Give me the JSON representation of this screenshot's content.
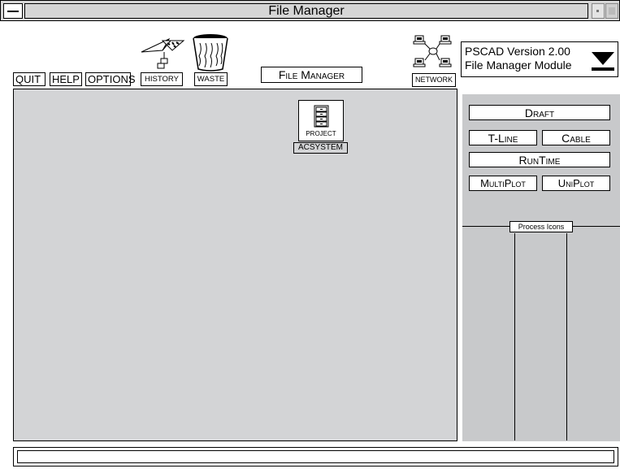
{
  "window": {
    "title": "File Manager"
  },
  "toolbar": {
    "quit_label": "QUIT",
    "help_label": "HELP",
    "options_label": "OPTIONS",
    "history_label": "HISTORY",
    "waste_label": "WASTE",
    "network_label": "NETWORK",
    "module_label": "File Manager"
  },
  "version": {
    "line1": "PSCAD Version 2.00",
    "line2": "File Manager Module"
  },
  "main": {
    "items": [
      {
        "type_label": "PROJECT",
        "name": "ACSYSTEM"
      }
    ]
  },
  "modules": {
    "draft": "Draft",
    "tline": "T-Line",
    "cable": "Cable",
    "runtime": "RunTime",
    "multiplot": "MultiPlot",
    "uniplot": "UniPlot"
  },
  "process": {
    "label": "Process Icons"
  },
  "status": {
    "text": ""
  },
  "icons": [
    "history-icon",
    "waste-icon",
    "network-icon",
    "project-icon",
    "menu-arrow-icon"
  ],
  "colors": {
    "pane": "#d3d4d6",
    "panel": "#c8c9cb",
    "titlebar": "#d6d6d6"
  }
}
